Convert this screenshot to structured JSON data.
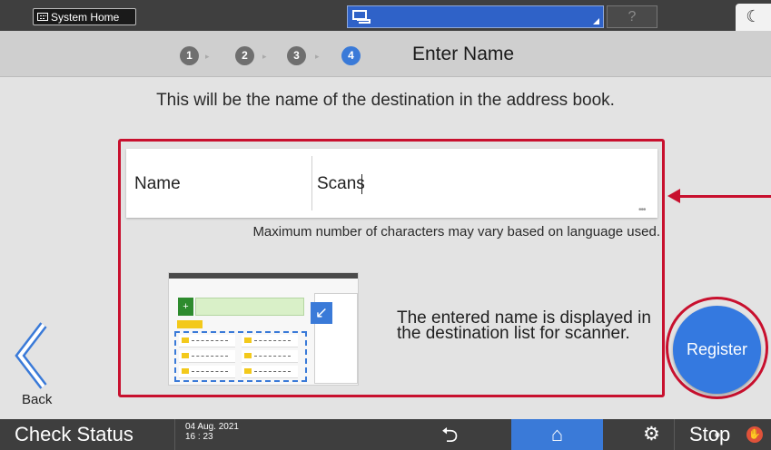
{
  "top_bar": {
    "system_home_label": "System Home",
    "help_label": "?",
    "energy_icon": "moon-icon"
  },
  "steps": {
    "numbers": [
      "1",
      "2",
      "3",
      "4"
    ],
    "active_index": 4,
    "title": "Enter Name"
  },
  "main": {
    "description": "This will be the name of the destination in the address book.",
    "name_field": {
      "label": "Name",
      "value": "Scans"
    },
    "hint": "Maximum number of characters may vary based on language used.",
    "illustration_caption_line1": "The entered name is displayed in",
    "illustration_caption_line2": "the destination list for scanner."
  },
  "actions": {
    "back_label": "Back",
    "register_label": "Register"
  },
  "bottom_bar": {
    "check_status": "Check Status",
    "date": "04 Aug. 2021",
    "time": "16 : 23",
    "stop_label": "Stop"
  },
  "colors": {
    "accent": "#3a7ad8",
    "annotation_red": "#c8102e"
  }
}
